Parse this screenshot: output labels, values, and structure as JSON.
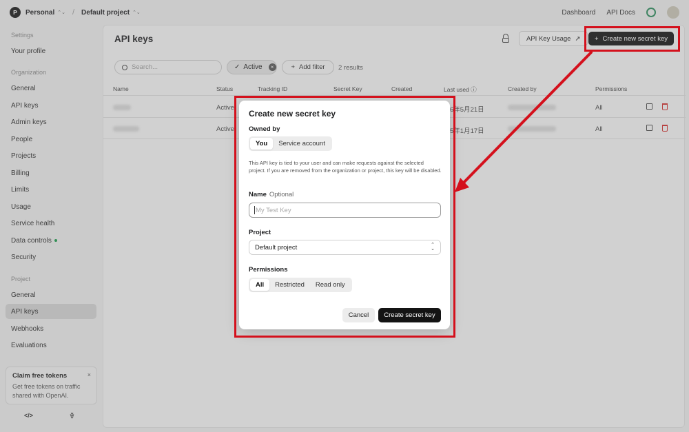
{
  "topbar": {
    "org_initial": "P",
    "org_name": "Personal",
    "project_name": "Default project",
    "links": [
      "Dashboard",
      "API Docs"
    ]
  },
  "sidebar": {
    "sections": {
      "settings": "Settings",
      "organization": "Organization",
      "project": "Project"
    },
    "settings_items": [
      "Your profile"
    ],
    "org_items": [
      "General",
      "API keys",
      "Admin keys",
      "People",
      "Projects",
      "Billing",
      "Limits",
      "Usage",
      "Service health",
      "Data controls",
      "Security"
    ],
    "project_items": [
      "General",
      "API keys",
      "Webhooks",
      "Evaluations"
    ],
    "active_item": "API keys",
    "claim": {
      "title": "Claim free tokens",
      "close": "×",
      "body": "Get free tokens on traffic shared with OpenAI."
    },
    "footer_icons": [
      "code-icon",
      "people-icon"
    ],
    "footer_glyphs": [
      "</>",
      "ꈊ"
    ]
  },
  "main": {
    "title": "API keys",
    "usage_button": "API Key Usage",
    "usage_arrow": "↗",
    "create_button": "Create new secret key",
    "plus": "+",
    "search_placeholder": "Search...",
    "filter_chip": "Active",
    "chip_close": "×",
    "add_filter": "Add filter",
    "results": "2 results",
    "columns": [
      "Name",
      "Status",
      "Tracking ID",
      "Secret Key",
      "Created",
      "Last used",
      "Created by",
      "Permissions"
    ],
    "last_used_info": "ⓘ",
    "rows": [
      {
        "status": "Active",
        "last_used": "6年5月21日",
        "permissions": "All"
      },
      {
        "status": "Active",
        "last_used": "5年1月17日",
        "permissions": "All"
      }
    ]
  },
  "modal": {
    "title": "Create new secret key",
    "owned_by_label": "Owned by",
    "owned_by_options": [
      "You",
      "Service account"
    ],
    "owned_by_selected": "You",
    "description": "This API key is tied to your user and can make requests against the selected project. If you are removed from the organization or project, this key will be disabled.",
    "name_label": "Name",
    "name_optional": "Optional",
    "name_placeholder": "My Test Key",
    "project_label": "Project",
    "project_value": "Default project",
    "permissions_label": "Permissions",
    "permissions_options": [
      "All",
      "Restricted",
      "Read only"
    ],
    "permissions_selected": "All",
    "cancel": "Cancel",
    "create": "Create secret key"
  },
  "colors": {
    "annotation_red": "#d4101c",
    "primary_dark": "#141414",
    "delete_red": "#d0302f",
    "status_green": "#1a9a4a"
  }
}
